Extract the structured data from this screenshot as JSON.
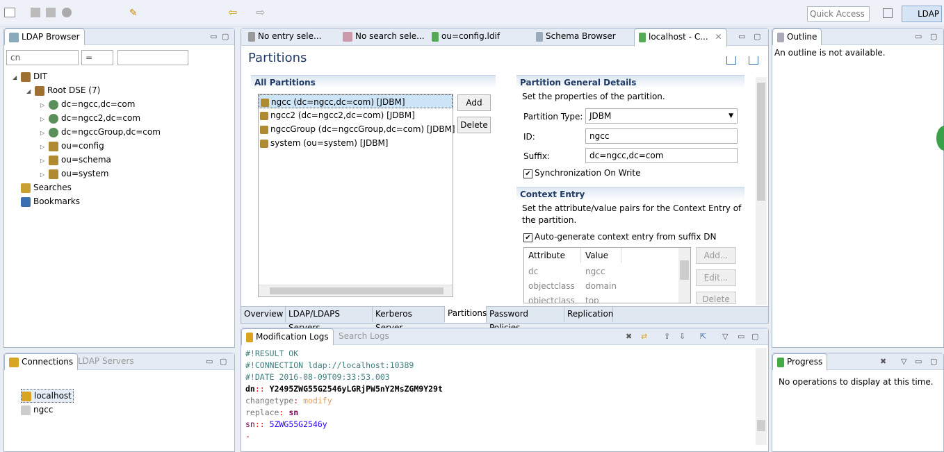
{
  "toolbar": {
    "quick_access_placeholder": "Quick Access",
    "perspective": "LDAP"
  },
  "browser": {
    "tab": "LDAP Browser",
    "filter_attr": "cn",
    "filter_op": "=",
    "filter_value": "",
    "tree": [
      {
        "label": "DIT",
        "level": 0
      },
      {
        "label": "Root DSE (7)",
        "level": 1
      },
      {
        "label": "dc=ngcc,dc=com",
        "level": 2,
        "icon": "globe"
      },
      {
        "label": "dc=ngcc2,dc=com",
        "level": 2,
        "icon": "globe"
      },
      {
        "label": "dc=ngccGroup,dc=com",
        "level": 2,
        "icon": "globe"
      },
      {
        "label": "ou=config",
        "level": 2,
        "icon": "org"
      },
      {
        "label": "ou=schema",
        "level": 2,
        "icon": "org"
      },
      {
        "label": "ou=system",
        "level": 2,
        "icon": "org"
      },
      {
        "label": "Searches",
        "level": 0,
        "icon": "search"
      },
      {
        "label": "Bookmarks",
        "level": 0,
        "icon": "book"
      }
    ]
  },
  "connections": {
    "tab_active": "Connections",
    "tab_inactive": "LDAP Servers",
    "items": [
      "localhost",
      "ngcc"
    ]
  },
  "editor": {
    "tabs": [
      "No entry sele...",
      "No search sele...",
      "ou=config.ldif",
      "Schema Browser",
      "localhost - C..."
    ],
    "title": "Partitions",
    "all_partitions": {
      "heading": "All Partitions",
      "items": [
        "ngcc (dc=ngcc,dc=com) [JDBM]",
        "ngcc2 (dc=ngcc2,dc=com) [JDBM]",
        "ngccGroup (dc=ngccGroup,dc=com) [JDBM]",
        "system (ou=system) [JDBM]"
      ],
      "add": "Add",
      "delete": "Delete"
    },
    "details": {
      "heading": "Partition General Details",
      "desc": "Set the properties of the partition.",
      "type_label": "Partition Type:",
      "type_value": "JDBM",
      "id_label": "ID:",
      "id_value": "ngcc",
      "suffix_label": "Suffix:",
      "suffix_value": "dc=ngcc,dc=com",
      "sync_label": "Synchronization On Write",
      "sync_checked": true
    },
    "context": {
      "heading": "Context Entry",
      "desc": "Set the attribute/value pairs for the Context Entry of the partition.",
      "auto_label": "Auto-generate context entry from suffix DN",
      "auto_checked": true,
      "col_attr": "Attribute",
      "col_value": "Value",
      "rows": [
        [
          "dc",
          "ngcc"
        ],
        [
          "objectclass",
          "domain"
        ],
        [
          "objectclass",
          "top"
        ]
      ],
      "add": "Add...",
      "edit": "Edit...",
      "delete": "Delete"
    },
    "bottom_tabs": [
      "Overview",
      "LDAP/LDAPS Servers",
      "Kerberos Server",
      "Partitions",
      "Password Policies",
      "Replication"
    ],
    "active_bottom_tab": "Partitions"
  },
  "logs": {
    "tab_active": "Modification Logs",
    "tab_inactive": "Search Logs",
    "lines": [
      {
        "parts": [
          {
            "t": "#!RESULT OK",
            "c": "#3f7f7f"
          }
        ]
      },
      {
        "parts": [
          {
            "t": "#!CONNECTION ldap://localhost:10389",
            "c": "#3f7f7f"
          }
        ]
      },
      {
        "parts": [
          {
            "t": "#!DATE 2016-08-09T09:33:53.003",
            "c": "#3f7f7f"
          }
        ]
      },
      {
        "parts": [
          {
            "t": "dn",
            "c": "#000",
            "b": true
          },
          {
            "t": ":: ",
            "c": "#e00"
          },
          {
            "t": "Y2495ZWG55G2546yLGRjPW5nY2MsZGM9Y29t",
            "c": "#000",
            "b": true
          }
        ]
      },
      {
        "parts": [
          {
            "t": "changetype",
            "c": "#777"
          },
          {
            "t": ": ",
            "c": "#e00"
          },
          {
            "t": "modify",
            "c": "#e0a060"
          }
        ]
      },
      {
        "parts": [
          {
            "t": "replace",
            "c": "#777"
          },
          {
            "t": ": ",
            "c": "#e00"
          },
          {
            "t": "sn",
            "c": "#7f0055",
            "b": true
          }
        ]
      },
      {
        "parts": [
          {
            "t": "sn",
            "c": "#7f0055"
          },
          {
            "t": ":: ",
            "c": "#e00"
          },
          {
            "t": "5ZWG55G2546y",
            "c": "#2a00ff"
          }
        ]
      },
      {
        "parts": [
          {
            "t": "-",
            "c": "#e00"
          }
        ]
      }
    ]
  },
  "outline": {
    "tab": "Outline",
    "message": "An outline is not available."
  },
  "progress": {
    "tab": "Progress",
    "message": "No operations to display at this time."
  }
}
